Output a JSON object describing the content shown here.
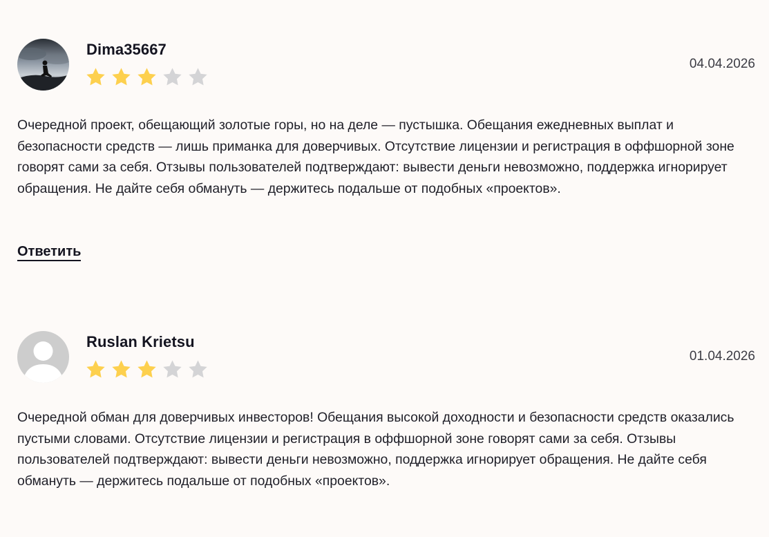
{
  "reviews": [
    {
      "author": "Dima35667",
      "date": "04.04.2026",
      "rating": 3,
      "max_rating": 5,
      "avatar": "photo-silhouette-avatar",
      "text": "Очередной проект, обещающий золотые горы, но на деле — пустышка. Обещания ежедневных выплат и безопасности средств — лишь приманка для доверчивых. Отсутствие лицензии и регистрация в оффшорной зоне говорят сами за себя. Отзывы пользователей подтверждают: вывести деньги невозможно, поддержка игнорирует обращения. Не дайте себя обмануть — держитесь подальше от подобных «проектов».",
      "reply_label": "Ответить"
    },
    {
      "author": "Ruslan Krietsu",
      "date": "01.04.2026",
      "rating": 3,
      "max_rating": 5,
      "avatar": "default-user-avatar",
      "text": "Очередной обман для доверчивых инвесторов! Обещания высокой доходности и безопасности средств оказались пустыми словами. Отсутствие лицензии и регистрация в оффшорной зоне говорят сами за себя. Отзывы пользователей подтверждают: вывести деньги невозможно, поддержка игнорирует обращения. Не дайте себя обмануть — держитесь подальше от подобных «проектов»."
    }
  ],
  "colors": {
    "background": "#fdfaf8",
    "star_filled": "#fdd04e",
    "star_empty": "#d4d4d6",
    "text": "#1f1f28"
  }
}
